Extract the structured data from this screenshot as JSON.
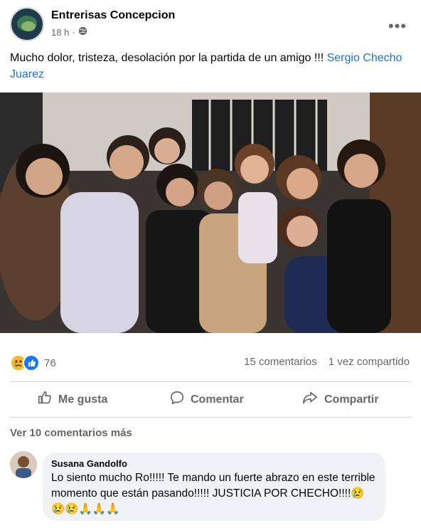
{
  "post": {
    "page_name": "Entrerisas Concepcion",
    "time": "18 h",
    "more_label": "•••",
    "text": "Mucho dolor, tristeza, desolación por la partida de un amigo !!! ",
    "mention": "Sergio Checho Juarez",
    "privacy_icon": "globe-icon"
  },
  "photo": {
    "description_icon": "group-photo"
  },
  "reactions": {
    "icons": [
      "sad-reaction-icon",
      "like-reaction-icon"
    ],
    "count": "76",
    "comments": "15 comentarios",
    "shares": "1 vez compartido"
  },
  "actions": {
    "like": "Me gusta",
    "comment": "Comentar",
    "share": "Compartir"
  },
  "comments": {
    "view_more": "Ver 10 comentarios más",
    "items": [
      {
        "author": "Susana Gandolfo",
        "text": "Lo siento mucho Ro!!!!! Te mando un fuerte abrazo en este terrible momento que están pasando!!!!! JUSTICIA POR CHECHO!!!!😢😢😢🙏🙏🙏"
      }
    ]
  },
  "colors": {
    "link": "#216fdb",
    "muted": "#65676b",
    "bubble": "#f0f2f5"
  }
}
